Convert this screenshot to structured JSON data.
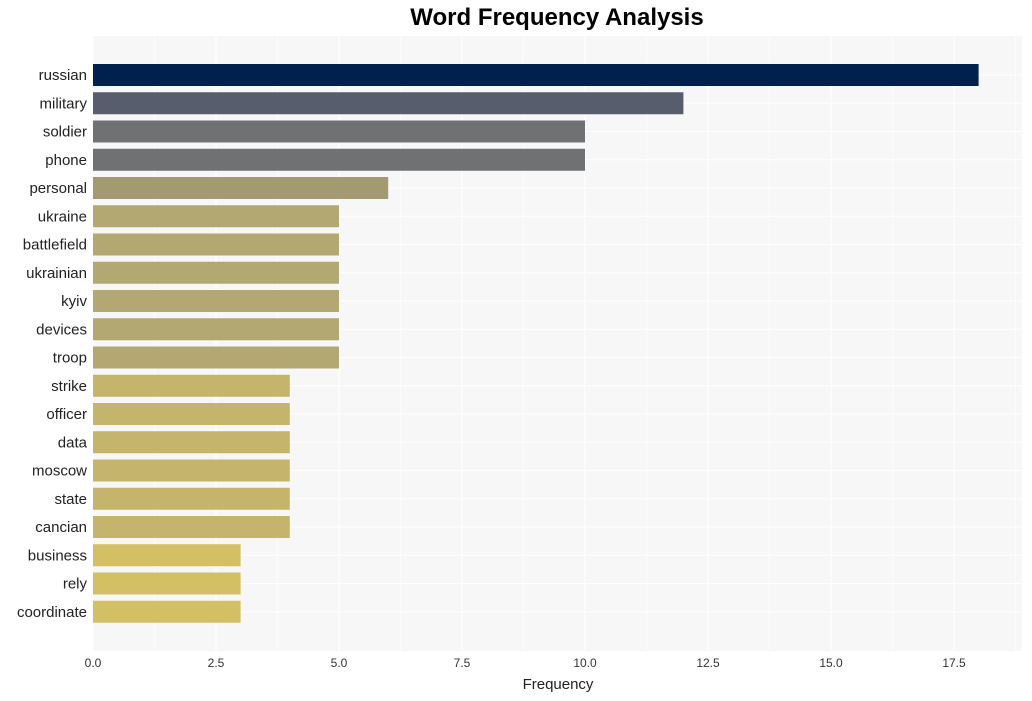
{
  "chart_data": {
    "type": "bar",
    "orientation": "horizontal",
    "title": "Word Frequency Analysis",
    "xlabel": "Frequency",
    "ylabel": "",
    "xlim": [
      0,
      18.9
    ],
    "xticks": [
      0.0,
      2.5,
      5.0,
      7.5,
      10.0,
      12.5,
      15.0,
      17.5
    ],
    "xtick_labels": [
      "0.0",
      "2.5",
      "5.0",
      "7.5",
      "10.0",
      "12.5",
      "15.0",
      "17.5"
    ],
    "grid": true,
    "categories": [
      "russian",
      "military",
      "soldier",
      "phone",
      "personal",
      "ukraine",
      "battlefield",
      "ukrainian",
      "kyiv",
      "devices",
      "troop",
      "strike",
      "officer",
      "data",
      "moscow",
      "state",
      "cancian",
      "business",
      "rely",
      "coordinate"
    ],
    "values": [
      18,
      12,
      10,
      10,
      6,
      5,
      5,
      5,
      5,
      5,
      5,
      4,
      4,
      4,
      4,
      4,
      4,
      3,
      3,
      3
    ],
    "colors": [
      "#00204e",
      "#575d6d",
      "#707173",
      "#707173",
      "#a39a72",
      "#b3a772",
      "#b3a772",
      "#b3a772",
      "#b3a772",
      "#b3a772",
      "#b3a772",
      "#c5b46c",
      "#c5b46c",
      "#c5b46c",
      "#c5b46c",
      "#c5b46c",
      "#c5b46c",
      "#d3c064",
      "#d3c064",
      "#d3c064"
    ],
    "background": "#f7f7f7"
  }
}
